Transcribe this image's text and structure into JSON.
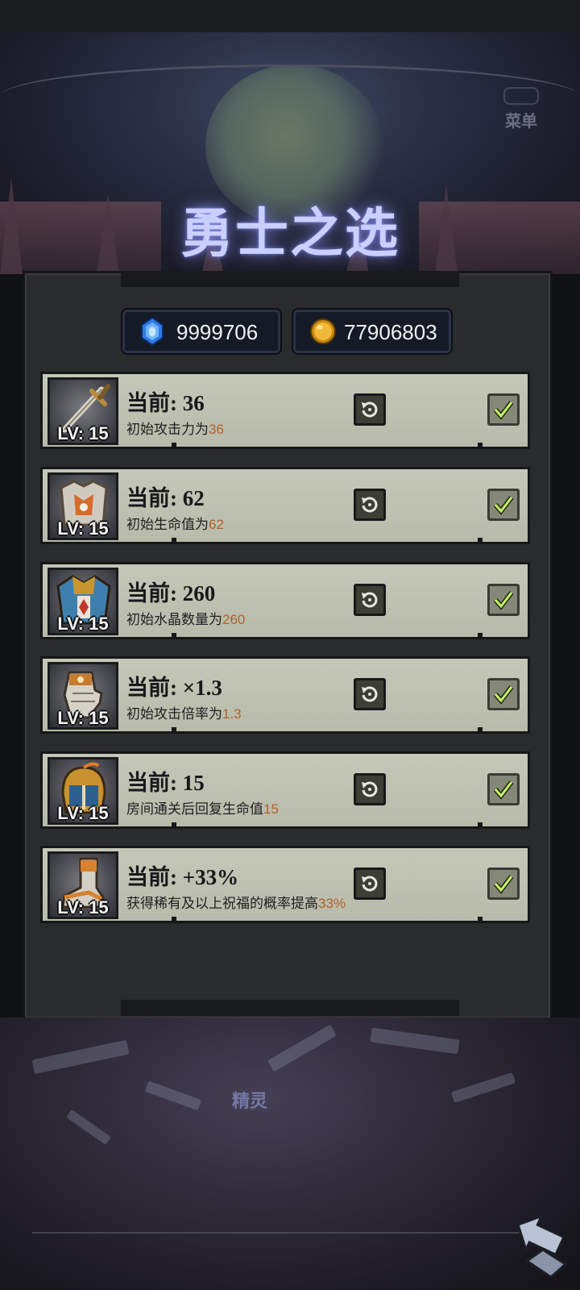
{
  "header": {
    "title": "勇士之选",
    "menu_label": "菜单"
  },
  "currencies": [
    {
      "icon": "blue-gem-icon",
      "value": "9999706"
    },
    {
      "icon": "gold-coin-icon",
      "value": "77906803"
    }
  ],
  "upgrades": [
    {
      "icon": "sword-icon",
      "level": "LV: 15",
      "current": "当前: 36",
      "desc_prefix": "初始攻击力为",
      "desc_value": "36"
    },
    {
      "icon": "chest-armor-icon",
      "level": "LV: 15",
      "current": "当前: 62",
      "desc_prefix": "初始生命值为",
      "desc_value": "62"
    },
    {
      "icon": "shoulder-armor-icon",
      "level": "LV: 15",
      "current": "当前: 260",
      "desc_prefix": "初始水晶数量为",
      "desc_value": "260"
    },
    {
      "icon": "gauntlet-icon",
      "level": "LV: 15",
      "current": "当前: ×1.3",
      "desc_prefix": "初始攻击倍率为",
      "desc_value": "1.3"
    },
    {
      "icon": "helmet-icon",
      "level": "LV: 15",
      "current": "当前: 15",
      "desc_prefix": "房间通关后回复生命值",
      "desc_value": "15"
    },
    {
      "icon": "boot-icon",
      "level": "LV: 15",
      "current": "当前: +33%",
      "desc_prefix": "获得稀有及以上祝福的概率提高",
      "desc_value": "33%"
    }
  ],
  "bottom": {
    "spirit_label": "精灵"
  },
  "colors": {
    "row_bg": "#c5c7b8",
    "highlight": "#b0622a",
    "title_glow": "#c9d0ff"
  }
}
